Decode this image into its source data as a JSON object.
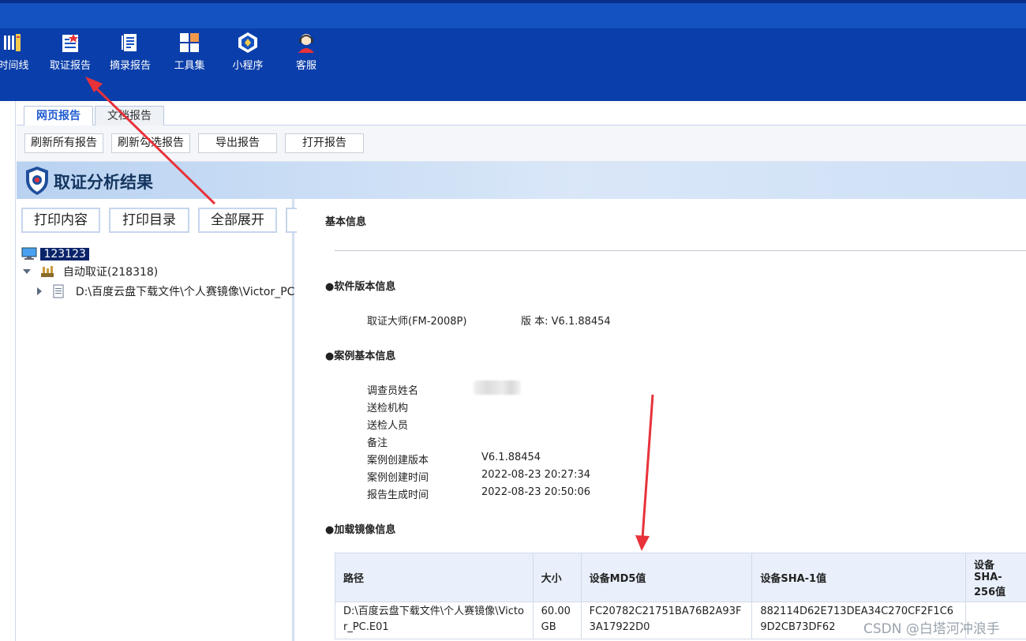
{
  "ribbon": {
    "items": [
      {
        "label": "时间线",
        "icon": "timeline-icon"
      },
      {
        "label": "取证报告",
        "icon": "report-icon"
      },
      {
        "label": "摘录报告",
        "icon": "excerpt-report-icon"
      },
      {
        "label": "工具集",
        "icon": "toolkit-icon"
      },
      {
        "label": "小程序",
        "icon": "mini-program-icon"
      },
      {
        "label": "客服",
        "icon": "customer-service-icon"
      }
    ]
  },
  "tabs": [
    {
      "label": "网页报告",
      "active": true
    },
    {
      "label": "文档报告",
      "active": false
    }
  ],
  "toolbar": {
    "buttons": [
      "刷新所有报告",
      "刷新勾选报告",
      "导出报告",
      "打开报告"
    ]
  },
  "banner": {
    "title": "取证分析结果"
  },
  "tree_pane": {
    "buttons": [
      "打印内容",
      "打印目录",
      "全部展开"
    ],
    "tree": {
      "root": "123123",
      "child": "自动取证(218318)",
      "grandchild": "D:\\百度云盘下载文件\\个人赛镜像\\Victor_PC"
    }
  },
  "report": {
    "section_basic": "基本信息",
    "section_software": "●软件版本信息",
    "software_name": "取证大师(FM-2008P)",
    "software_version": "版 本: V6.1.88454",
    "section_case": "●案例基本信息",
    "case_rows": [
      {
        "label": "调查员姓名",
        "value": ""
      },
      {
        "label": "送检机构",
        "value": ""
      },
      {
        "label": "送检人员",
        "value": ""
      },
      {
        "label": "备注",
        "value": ""
      },
      {
        "label": "案例创建版本",
        "value": "V6.1.88454"
      },
      {
        "label": "案例创建时间",
        "value": "2022-08-23 20:27:34"
      },
      {
        "label": "报告生成时间",
        "value": "2022-08-23 20:50:06"
      }
    ],
    "section_image": "●加载镜像信息",
    "image_table": {
      "headers": [
        "路径",
        "大小",
        "设备MD5值",
        "设备SHA-1值",
        "设备SHA-256值"
      ],
      "rows": [
        [
          "D:\\百度云盘下载文件\\个人赛镜像\\Victor_PC.E01",
          "60.00 GB",
          "FC20782C21751BA76B2A93F3A17922D0",
          "882114D62E713DEA34C270CF2F1C69D2CB73DF62",
          ""
        ]
      ]
    }
  },
  "watermark": "CSDN @白塔河冲浪手",
  "colors": {
    "ribbon": "#0a3eaa",
    "accent": "#1f5bd0",
    "arrow": "#e8323a",
    "tree_selection": "#0a246a"
  }
}
